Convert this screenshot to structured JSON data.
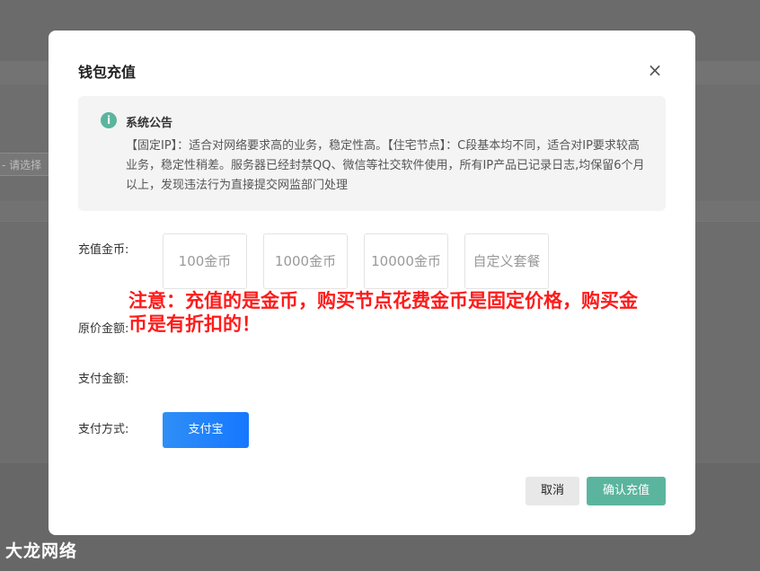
{
  "background": {
    "input_placeholder": "- 请选择",
    "watermark": "大龙网络"
  },
  "modal": {
    "title": "钱包充值",
    "close_glyph": "×",
    "notice": {
      "icon_glyph": "i",
      "title": "系统公告",
      "body": "【固定IP】：适合对网络要求高的业务，稳定性高。【住宅节点】：C段基本均不同，适合对IP要求较高业务，稳定性稍差。服务器已经封禁QQ、微信等社交软件使用，所有IP产品已记录日志,均保留6个月以上，发现违法行为直接提交网监部门处理"
    },
    "labels": {
      "recharge_coins": "充值金币:",
      "original_amount": "原价金额:",
      "pay_amount": "支付金额:",
      "pay_method": "支付方式:"
    },
    "coin_options": [
      "100金币",
      "1000金币",
      "10000金币",
      "自定义套餐"
    ],
    "pay_method": "支付宝",
    "buttons": {
      "cancel": "取消",
      "confirm": "确认充值"
    },
    "annotation": "注意：充值的是金币，购买节点花费金币是固定价格，购买金币是有折扣的！"
  },
  "colors": {
    "accent": "#5bb59e",
    "pay_blue": "#1677ff",
    "annotation_red": "#ff1a1a",
    "overlay": "#6b6b6b"
  }
}
